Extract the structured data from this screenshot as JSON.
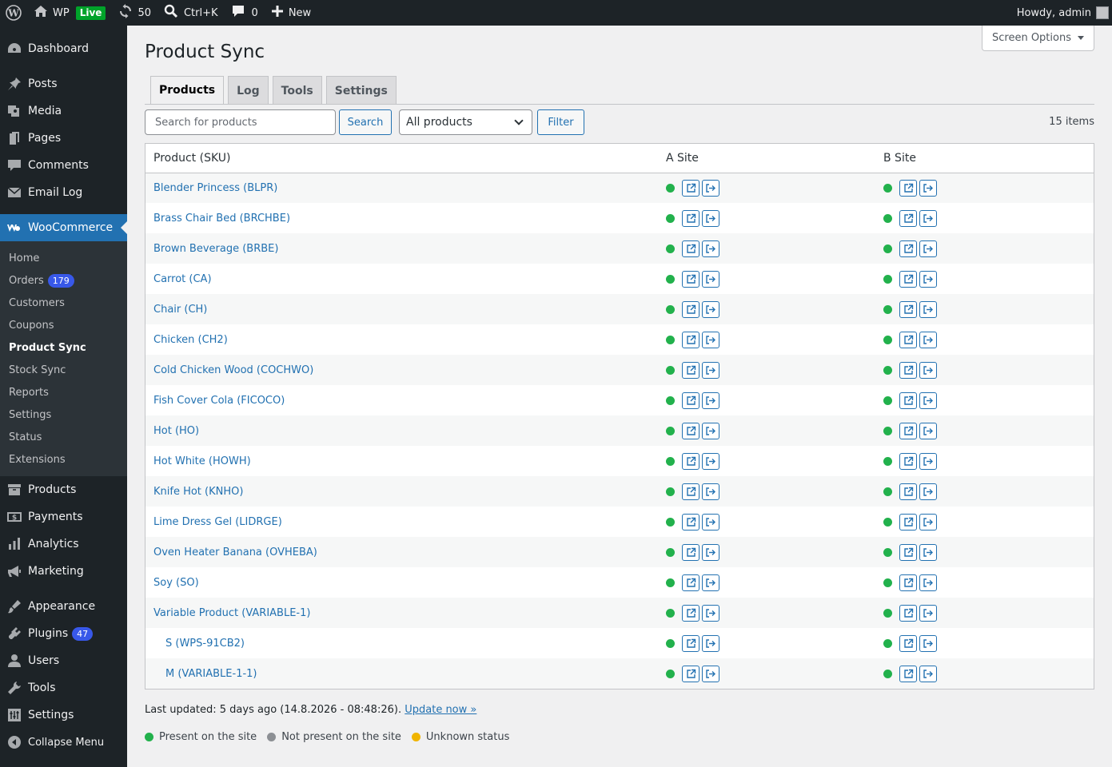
{
  "adminbar": {
    "site_name": "WP",
    "live_label": "Live",
    "updates_count": "50",
    "search_shortcut": "Ctrl+K",
    "comments_count": "0",
    "new_label": "New",
    "howdy": "Howdy, admin"
  },
  "sidebar": {
    "dashboard": "Dashboard",
    "posts": "Posts",
    "media": "Media",
    "pages": "Pages",
    "comments": "Comments",
    "email_log": "Email Log",
    "woocommerce": "WooCommerce",
    "woo_sub": {
      "home": "Home",
      "orders": "Orders",
      "orders_count": "179",
      "customers": "Customers",
      "coupons": "Coupons",
      "product_sync": "Product Sync",
      "stock_sync": "Stock Sync",
      "reports": "Reports",
      "settings": "Settings",
      "status": "Status",
      "extensions": "Extensions"
    },
    "products": "Products",
    "payments": "Payments",
    "analytics": "Analytics",
    "marketing": "Marketing",
    "appearance": "Appearance",
    "plugins": "Plugins",
    "plugins_count": "47",
    "users": "Users",
    "tools": "Tools",
    "settings": "Settings",
    "collapse": "Collapse Menu"
  },
  "page": {
    "screen_options": "Screen Options",
    "title": "Product Sync",
    "tabs": [
      "Products",
      "Log",
      "Tools",
      "Settings"
    ],
    "search_placeholder": "Search for products",
    "search_button": "Search",
    "filter_select": "All products",
    "filter_button": "Filter",
    "items_count": "15 items",
    "columns": [
      "Product (SKU)",
      "A Site",
      "B Site"
    ],
    "rows": [
      {
        "name": "Blender Princess (BLPR)",
        "child": false,
        "a_status": "present",
        "b_status": "present"
      },
      {
        "name": "Brass Chair Bed (BRCHBE)",
        "child": false,
        "a_status": "present",
        "b_status": "present"
      },
      {
        "name": "Brown Beverage (BRBE)",
        "child": false,
        "a_status": "present",
        "b_status": "present"
      },
      {
        "name": "Carrot (CA)",
        "child": false,
        "a_status": "present",
        "b_status": "present"
      },
      {
        "name": "Chair (CH)",
        "child": false,
        "a_status": "present",
        "b_status": "present"
      },
      {
        "name": "Chicken (CH2)",
        "child": false,
        "a_status": "present",
        "b_status": "present"
      },
      {
        "name": "Cold Chicken Wood (COCHWO)",
        "child": false,
        "a_status": "present",
        "b_status": "present"
      },
      {
        "name": "Fish Cover Cola (FICOCO)",
        "child": false,
        "a_status": "present",
        "b_status": "present"
      },
      {
        "name": "Hot (HO)",
        "child": false,
        "a_status": "present",
        "b_status": "present"
      },
      {
        "name": "Hot White (HOWH)",
        "child": false,
        "a_status": "present",
        "b_status": "present"
      },
      {
        "name": "Knife Hot (KNHO)",
        "child": false,
        "a_status": "present",
        "b_status": "present"
      },
      {
        "name": "Lime Dress Gel (LIDRGE)",
        "child": false,
        "a_status": "present",
        "b_status": "present"
      },
      {
        "name": "Oven Heater Banana (OVHEBA)",
        "child": false,
        "a_status": "present",
        "b_status": "present"
      },
      {
        "name": "Soy (SO)",
        "child": false,
        "a_status": "present",
        "b_status": "present"
      },
      {
        "name": "Variable Product (VARIABLE-1)",
        "child": false,
        "a_status": "present",
        "b_status": "present"
      },
      {
        "name": "S (WPS-91CB2)",
        "child": true,
        "a_status": "present",
        "b_status": "present"
      },
      {
        "name": "M (VARIABLE-1-1)",
        "child": true,
        "a_status": "present",
        "b_status": "present"
      }
    ],
    "last_updated_text": "Last updated: 5 days ago (14.8.2026 - 08:48:26).",
    "update_now": "Update now »",
    "legend": [
      {
        "label": "Present on the site",
        "color": "#22b14c"
      },
      {
        "label": "Not present on the site",
        "color": "#8c8f94"
      },
      {
        "label": "Unknown status",
        "color": "#f0b400"
      }
    ]
  },
  "colors": {
    "accent": "#2271b1",
    "woo_highlight": "#2271b1",
    "badge": "#3858e9",
    "present": "#22b14c"
  }
}
